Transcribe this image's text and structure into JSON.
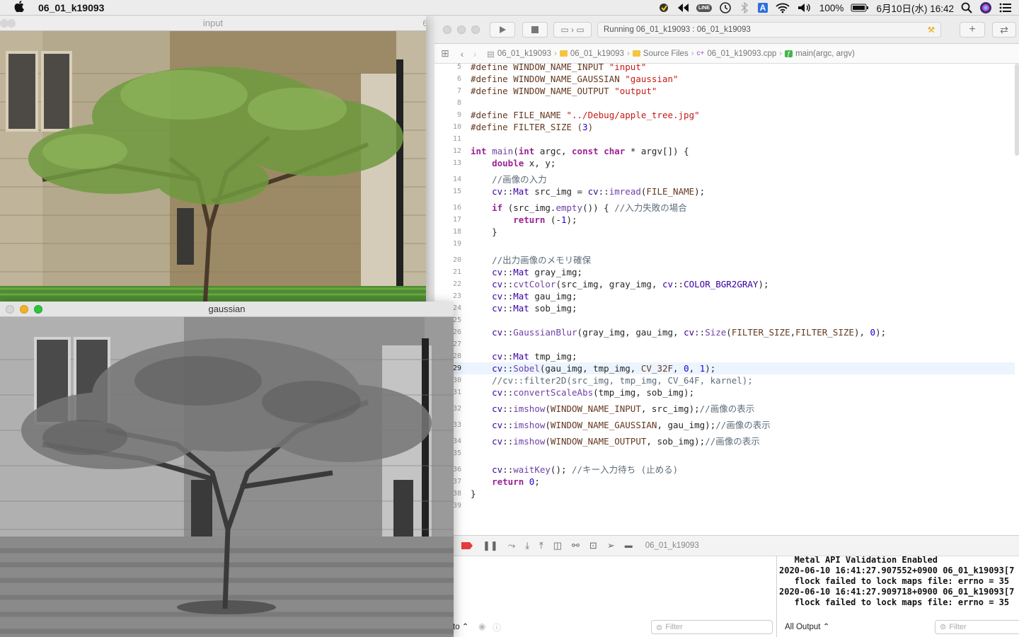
{
  "menubar": {
    "app_name": "06_01_k19093",
    "battery": "100%",
    "clock": "6月10日(水)  16:42",
    "line_icon_label": "LINE",
    "input_source_label": "A"
  },
  "input_window": {
    "title": "input",
    "peek_label": "6"
  },
  "gaussian_window": {
    "title": "gaussian"
  },
  "xcode": {
    "activity": "Running 06_01_k19093 : 06_01_k19093",
    "breadcrumbs": [
      "06_01_k19093",
      "06_01_k19093",
      "Source Files",
      "06_01_k19093.cpp",
      "main(argc, argv)"
    ],
    "highlighted_line": "29",
    "code_lines": [
      {
        "n": "5",
        "t": "#define WINDOW_NAME_INPUT \"input\""
      },
      {
        "n": "6",
        "t": "#define WINDOW_NAME_GAUSSIAN \"gaussian\""
      },
      {
        "n": "7",
        "t": "#define WINDOW_NAME_OUTPUT \"output\""
      },
      {
        "n": "8",
        "t": ""
      },
      {
        "n": "9",
        "t": "#define FILE_NAME \"../Debug/apple_tree.jpg\""
      },
      {
        "n": "10",
        "t": "#define FILTER_SIZE (3)"
      },
      {
        "n": "11",
        "t": ""
      },
      {
        "n": "12",
        "t": "int main(int argc, const char * argv[]) {"
      },
      {
        "n": "13",
        "t": "    double x, y;"
      },
      {
        "n": "14",
        "t": "    //画像の入力"
      },
      {
        "n": "15",
        "t": "    cv::Mat src_img = cv::imread(FILE_NAME);"
      },
      {
        "n": "16",
        "t": "    if (src_img.empty()) { //入力失敗の場合"
      },
      {
        "n": "17",
        "t": "        return (-1);"
      },
      {
        "n": "18",
        "t": "    }"
      },
      {
        "n": "19",
        "t": ""
      },
      {
        "n": "20",
        "t": "    //出力画像のメモリ確保"
      },
      {
        "n": "21",
        "t": "    cv::Mat gray_img;"
      },
      {
        "n": "22",
        "t": "    cv::cvtColor(src_img, gray_img, cv::COLOR_BGR2GRAY);"
      },
      {
        "n": "23",
        "t": "    cv::Mat gau_img;"
      },
      {
        "n": "24",
        "t": "    cv::Mat sob_img;"
      },
      {
        "n": "25",
        "t": ""
      },
      {
        "n": "26",
        "t": "    cv::GaussianBlur(gray_img, gau_img, cv::Size(FILTER_SIZE,FILTER_SIZE), 0);"
      },
      {
        "n": "27",
        "t": ""
      },
      {
        "n": "28",
        "t": "    cv::Mat tmp_img;"
      },
      {
        "n": "29",
        "t": "    cv::Sobel(gau_img, tmp_img, CV_32F, 0, 1);"
      },
      {
        "n": "30",
        "t": "    //cv::filter2D(src_img, tmp_img, CV_64F, karnel);"
      },
      {
        "n": "31",
        "t": "    cv::convertScaleAbs(tmp_img, sob_img);"
      },
      {
        "n": "32",
        "t": "    cv::imshow(WINDOW_NAME_INPUT, src_img);//画像の表示"
      },
      {
        "n": "33",
        "t": "    cv::imshow(WINDOW_NAME_GAUSSIAN, gau_img);//画像の表示"
      },
      {
        "n": "34",
        "t": "    cv::imshow(WINDOW_NAME_OUTPUT, sob_img);//画像の表示"
      },
      {
        "n": "35",
        "t": ""
      },
      {
        "n": "36",
        "t": "    cv::waitKey(); //キー入力待ち (止める)"
      },
      {
        "n": "37",
        "t": "    return 0;"
      },
      {
        "n": "38",
        "t": "}"
      },
      {
        "n": "39",
        "t": ""
      }
    ],
    "debug_target": "06_01_k19093",
    "console_lines": [
      "   Metal API Validation Enabled",
      "2020-06-10 16:41:27.907552+0900 06_01_k19093[7",
      "   flock failed to lock maps file: errno = 35",
      "2020-06-10 16:41:27.909718+0900 06_01_k19093[7",
      "   flock failed to lock maps file: errno = 35"
    ],
    "filter_placeholder": "Filter",
    "console_filter_placeholder": "Filter",
    "output_selector": "All Output ⌃",
    "auto_selector": "to ⌃"
  }
}
